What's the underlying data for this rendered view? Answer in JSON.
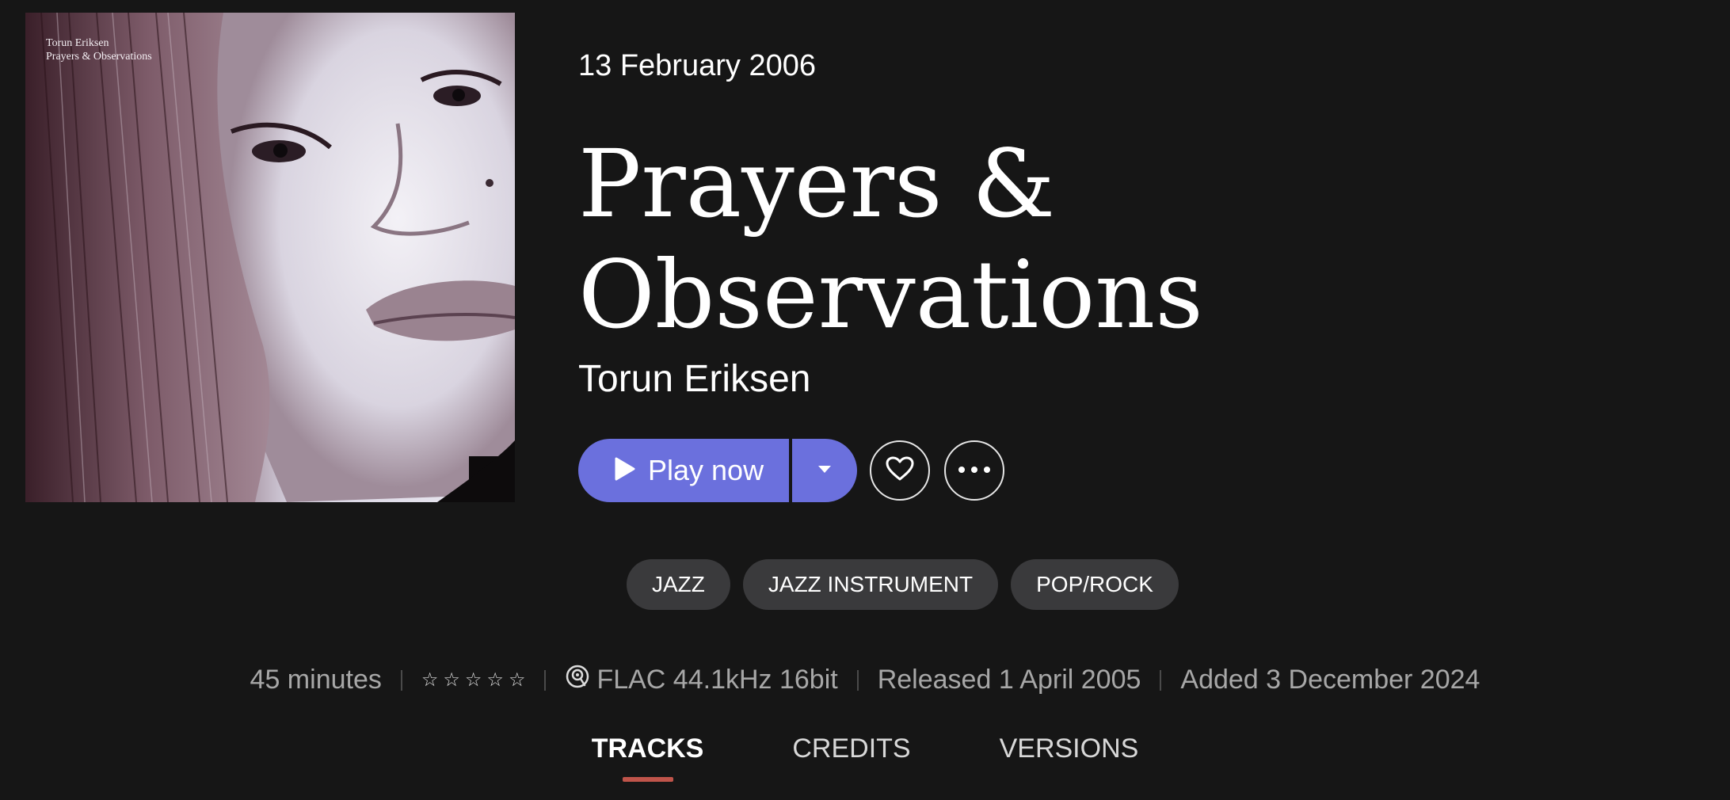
{
  "album": {
    "cover_text": {
      "artist": "Torun Eriksen",
      "title": "Prayers & Observations"
    },
    "date": "13 February 2006",
    "title_line1": "Prayers &",
    "title_line2": "Observations",
    "artist": "Torun Eriksen"
  },
  "actions": {
    "play_label": "Play now",
    "icons": {
      "play": "play-icon",
      "dropdown": "caret-down-icon",
      "favorite": "heart-icon",
      "more": "ellipsis-icon"
    }
  },
  "genres": [
    "JAZZ",
    "JAZZ INSTRUMENT",
    "POP/ROCK"
  ],
  "meta": {
    "duration": "45 minutes",
    "rating": 0,
    "rating_max": 5,
    "quality": "FLAC 44.1kHz 16bit",
    "released": "Released 1 April 2005",
    "added": "Added 3 December 2024"
  },
  "tabs": [
    {
      "label": "TRACKS",
      "active": true
    },
    {
      "label": "CREDITS",
      "active": false
    },
    {
      "label": "VERSIONS",
      "active": false
    }
  ],
  "colors": {
    "background": "#161616",
    "accent": "#6b70dd",
    "chip": "#3a3a3c",
    "tab_indicator": "#c0544a"
  }
}
